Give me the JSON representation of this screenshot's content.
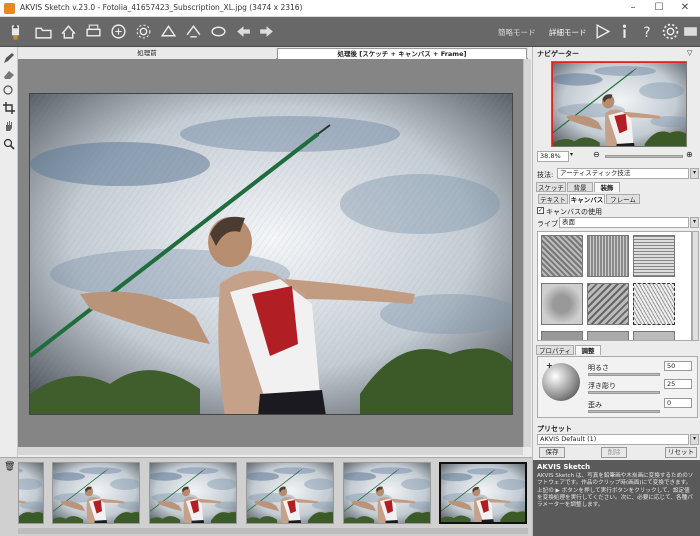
{
  "window": {
    "title": "AKVIS Sketch v.23.0 - Fotolia_41657423_Subscription_XL.jpg (3474 x 2316)"
  },
  "toolbar": {
    "mode_simple": "簡略モード",
    "mode_advanced": "詳細モード"
  },
  "tabs": {
    "before": "処理前",
    "after": "処理後 [スケッチ + キャンバス + Frame]"
  },
  "navigator": {
    "title": "ナビゲーター",
    "zoom": "38.8%"
  },
  "style": {
    "label": "技法:",
    "value": "アーティスティック技法"
  },
  "main_tabs": [
    "スケッチ",
    "背景",
    "装飾"
  ],
  "sub_tabs": [
    "テキスト",
    "キャンバス",
    "フレーム"
  ],
  "canvas_panel": {
    "use_canvas": "キャンバスの使用",
    "library_label": "ライブラリ",
    "library_value": "表面"
  },
  "prop_tabs": [
    "プロパティ",
    "調整"
  ],
  "adjust": {
    "brightness_label": "明るさ",
    "brightness": "50",
    "relief_label": "浮き彫り",
    "relief": "25",
    "distortion_label": "歪み",
    "distortion": "0"
  },
  "presets": {
    "title": "プリセット",
    "value": "AKVIS Default (1)",
    "save": "保存",
    "delete": "削除",
    "reset": "リセット"
  },
  "info": {
    "title": "AKVIS Sketch",
    "body": "AKVIS Sketch は、写真を鉛筆画や木炭画に変換するためのソフトウェアです。作品のクリップ時(画面)にて変換できます。上記の ▶ ボタンを押して実行ボタンをクリックして、設定値を変換処理を実行してください。次に、必要に応じて、各種パラメーターを調整します。"
  },
  "colors": {
    "toolbar_bg": "#686868",
    "canvas_bg": "#858585",
    "panel_bg": "#ececec"
  }
}
